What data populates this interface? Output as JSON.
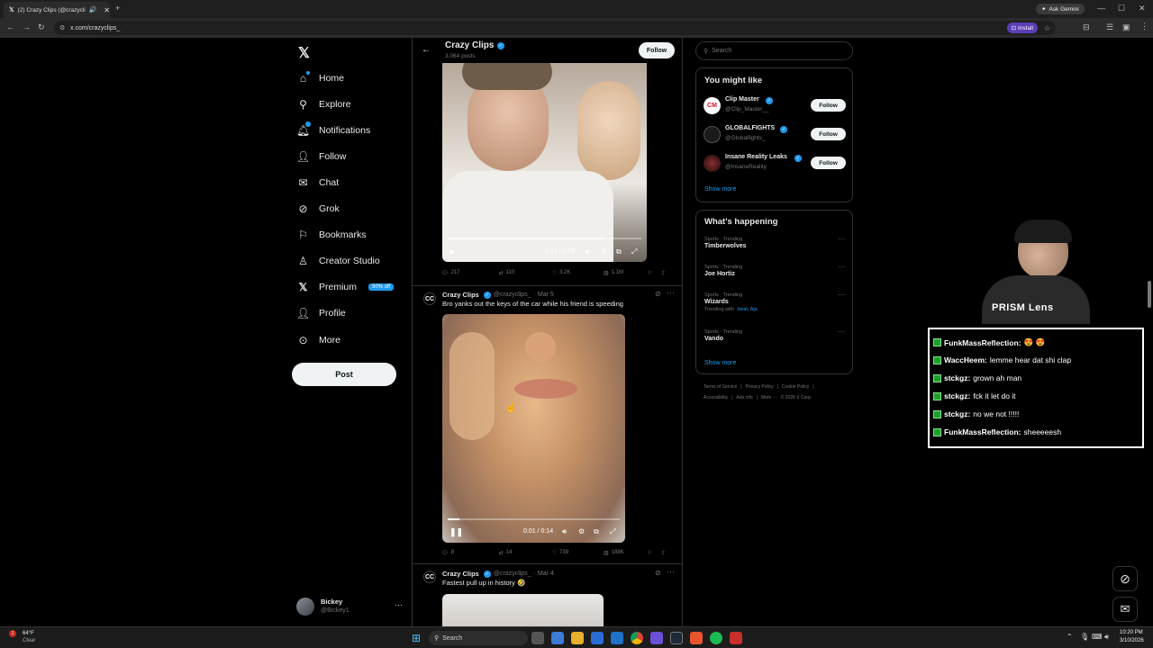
{
  "browser": {
    "tab_title": "(2) Crazy Clips (@crazyclip",
    "url": "x.com/crazyclips_",
    "ask_gemini": "Ask Gemini",
    "install": "Install"
  },
  "nav": {
    "items": [
      {
        "label": "Home",
        "icon": "home-icon"
      },
      {
        "label": "Explore",
        "icon": "search-icon"
      },
      {
        "label": "Notifications",
        "icon": "bell-icon"
      },
      {
        "label": "Follow",
        "icon": "person-plus-icon"
      },
      {
        "label": "Chat",
        "icon": "mail-icon"
      },
      {
        "label": "Grok",
        "icon": "grok-icon"
      },
      {
        "label": "Bookmarks",
        "icon": "bookmark-icon"
      },
      {
        "label": "Creator Studio",
        "icon": "creator-icon"
      },
      {
        "label": "Premium",
        "icon": "x-icon"
      },
      {
        "label": "Profile",
        "icon": "person-icon"
      },
      {
        "label": "More",
        "icon": "more-circle-icon"
      }
    ],
    "premium_badge": "50% off",
    "post_label": "Post",
    "user_name": "Bickey",
    "user_handle": "@Bickey1"
  },
  "header": {
    "title": "Crazy Clips",
    "posts_count": "3,064 posts",
    "follow_label": "Follow"
  },
  "video1": {
    "time": "0:12 / 0:15",
    "progress": 0.8,
    "stats": {
      "replies": "217",
      "reposts": "110",
      "likes": "3.2K",
      "views": "1.1M"
    }
  },
  "post2": {
    "name": "Crazy Clips",
    "handle": "@crazyclips_",
    "date": "· Mar 5",
    "text": "Bro yanks out the keys of the car while his friend is speeding",
    "video_time": "0:01 / 0:14",
    "progress": 0.07,
    "stats": {
      "replies": "8",
      "reposts": "14",
      "likes": "739",
      "views": "188K"
    }
  },
  "post3": {
    "name": "Crazy Clips",
    "handle": "@crazyclips_",
    "date": "· Mar 4",
    "text": "Fastest pull up in history 🤣"
  },
  "search": {
    "placeholder": "Search"
  },
  "you_might_like": {
    "title": "You might like",
    "accounts": [
      {
        "name": "Clip Master",
        "handle": "@Clip_Master__",
        "follow": "Follow"
      },
      {
        "name": "GLOBALFIGHTS",
        "handle": "@Globalfights_",
        "follow": "Follow"
      },
      {
        "name": "Insane Reality Leaks",
        "handle": "@InsaneReality",
        "follow": "Follow"
      }
    ],
    "show_more": "Show more"
  },
  "whats_happening": {
    "title": "What's happening",
    "trends": [
      {
        "category": "Sports · Trending",
        "name": "Timberwolves",
        "extra": ""
      },
      {
        "category": "Sports · Trending",
        "name": "Joe Hortiz",
        "extra": ""
      },
      {
        "category": "Sports · Trending",
        "name": "Wizards",
        "extra": "Trending with",
        "extra_links": "Heat, Aja"
      },
      {
        "category": "Sports · Trending",
        "name": "Vando",
        "extra": ""
      }
    ],
    "show_more": "Show more"
  },
  "footer": {
    "line1": [
      "Terms of Service",
      "|",
      "Privacy Policy",
      "|",
      "Cookie Policy",
      "|"
    ],
    "line2": [
      "Accessibility",
      "|",
      "Ads info",
      "|",
      "More ···",
      "© 2026 X Corp."
    ]
  },
  "overlay": {
    "brand": "PRISM Lens",
    "chat": [
      {
        "user": "FunkMassReflection:",
        "msg": "😍 😍"
      },
      {
        "user": "WaccHeem:",
        "msg": "lemme hear dat shi clap"
      },
      {
        "user": "stckgz:",
        "msg": "grown ah man"
      },
      {
        "user": "stckgz:",
        "msg": "fck it let do it"
      },
      {
        "user": "stckgz:",
        "msg": "no we not !!!!!"
      },
      {
        "user": "FunkMassReflection:",
        "msg": "sheeeeesh"
      }
    ]
  },
  "taskbar": {
    "weather_temp": "64°F",
    "weather_desc": "Clear",
    "search_label": "Search",
    "time": "10:20 PM",
    "date": "3/10/2026",
    "notif_count": "1"
  },
  "colors": {
    "accent": "#1d9bf0",
    "bg": "#000000",
    "border": "#2f3336"
  }
}
